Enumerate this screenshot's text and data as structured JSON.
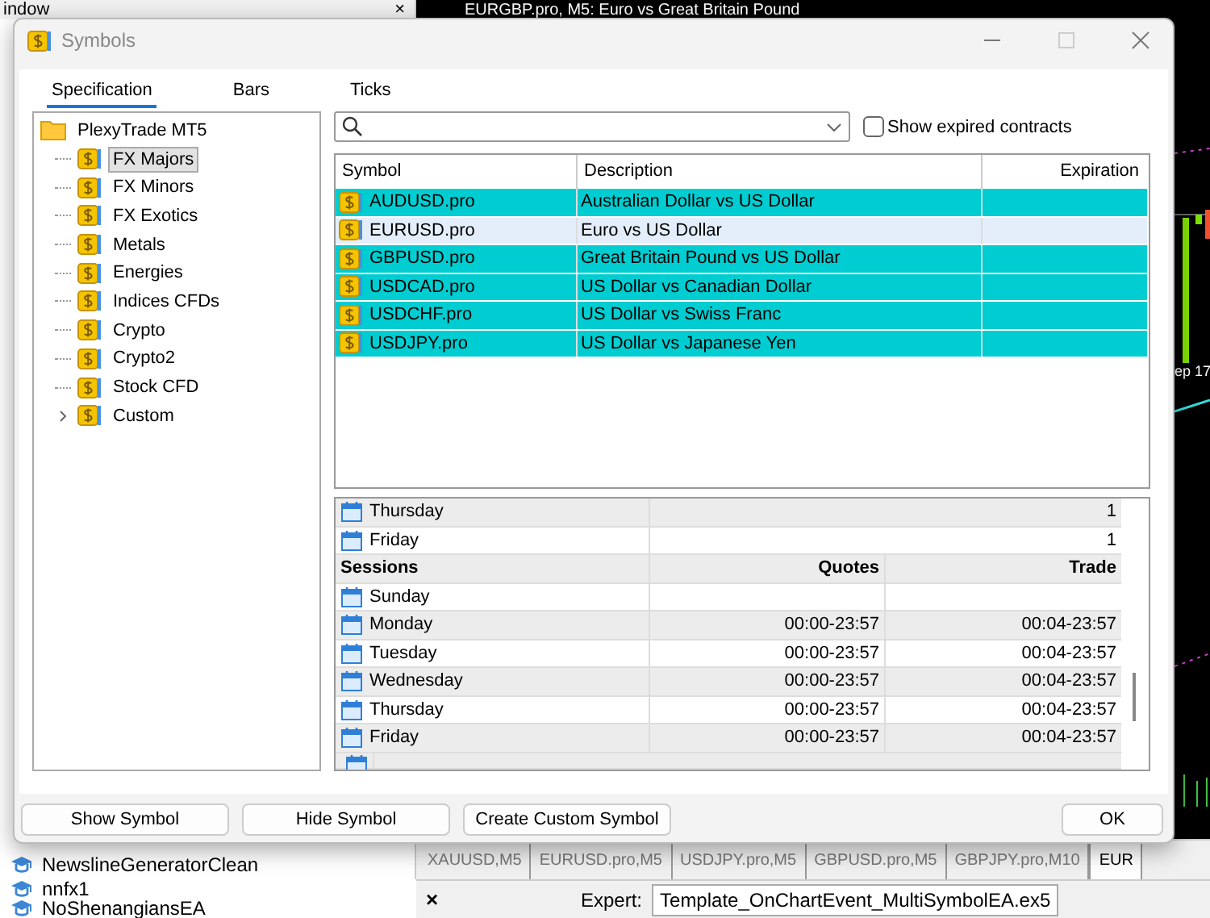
{
  "background": {
    "panel_title": "indow",
    "panel_close": "×",
    "chart_title": "EURGBP.pro, M5: Euro vs Great Britain Pound",
    "chart_date": "ep 17",
    "navigator_items": [
      "NewslineGeneratorClean",
      "nnfx1",
      "NoShenangiansEA"
    ],
    "chart_tabs": [
      {
        "label": "XAUUSD,M5",
        "selected": false
      },
      {
        "label": "EURUSD.pro,M5",
        "selected": false
      },
      {
        "label": "USDJPY.pro,M5",
        "selected": false
      },
      {
        "label": "GBPUSD.pro,M5",
        "selected": false
      },
      {
        "label": "GBPJPY.pro,M10",
        "selected": false
      },
      {
        "label": "EUR",
        "selected": true
      }
    ],
    "toolbox_close": "×",
    "expert_label": "Expert:",
    "expert_value": "Template_OnChartEvent_MultiSymbolEA.ex5"
  },
  "window": {
    "title": "Symbols"
  },
  "tabs": [
    {
      "label": "Specification",
      "selected": true
    },
    {
      "label": "Bars",
      "selected": false
    },
    {
      "label": "Ticks",
      "selected": false
    }
  ],
  "tree": {
    "label": "PlexyTrade MT5",
    "children": [
      {
        "label": "FX Majors",
        "selected": true
      },
      {
        "label": "FX Minors",
        "selected": false
      },
      {
        "label": "FX Exotics",
        "selected": false
      },
      {
        "label": "Metals",
        "selected": false
      },
      {
        "label": "Energies",
        "selected": false
      },
      {
        "label": "Indices CFDs",
        "selected": false
      },
      {
        "label": "Crypto",
        "selected": false
      },
      {
        "label": "Crypto2",
        "selected": false
      },
      {
        "label": "Stock CFD",
        "selected": false
      },
      {
        "label": "Custom",
        "selected": false,
        "expanded": false
      }
    ]
  },
  "show_expired": {
    "label": "Show expired contracts",
    "checked": false
  },
  "symbols": {
    "columns": [
      "Symbol",
      "Description",
      "Expiration"
    ],
    "rows": [
      {
        "symbol": "AUDUSD.pro",
        "description": "Australian Dollar vs US Dollar",
        "selected": true
      },
      {
        "symbol": "EURUSD.pro",
        "description": "Euro vs US Dollar",
        "selected": false
      },
      {
        "symbol": "GBPUSD.pro",
        "description": "Great Britain Pound vs US Dollar",
        "selected": true
      },
      {
        "symbol": "USDCAD.pro",
        "description": "US Dollar vs Canadian Dollar",
        "selected": true
      },
      {
        "symbol": "USDCHF.pro",
        "description": "US Dollar vs Swiss Franc",
        "selected": true
      },
      {
        "symbol": "USDJPY.pro",
        "description": "US Dollar vs Japanese Yen",
        "selected": true
      }
    ]
  },
  "sessions": {
    "rows": [
      {
        "kind": "count",
        "label": "Thursday",
        "value": "1"
      },
      {
        "kind": "count",
        "label": "Friday",
        "value": "1"
      },
      {
        "kind": "header",
        "label": "Sessions",
        "quotes": "Quotes",
        "trade": "Trade"
      },
      {
        "kind": "session",
        "label": "Sunday"
      },
      {
        "kind": "session",
        "label": "Monday",
        "quotes": "00:00-23:57",
        "trade": "00:04-23:57"
      },
      {
        "kind": "session",
        "label": "Tuesday",
        "quotes": "00:00-23:57",
        "trade": "00:04-23:57"
      },
      {
        "kind": "session",
        "label": "Wednesday",
        "quotes": "00:00-23:57",
        "trade": "00:04-23:57"
      },
      {
        "kind": "session",
        "label": "Thursday",
        "quotes": "00:00-23:57",
        "trade": "00:04-23:57"
      },
      {
        "kind": "session",
        "label": "Friday",
        "quotes": "00:00-23:57",
        "trade": "00:04-23:57"
      }
    ]
  },
  "buttons": [
    "Show Symbol",
    "Hide Symbol",
    "Create Custom Symbol",
    "OK"
  ]
}
